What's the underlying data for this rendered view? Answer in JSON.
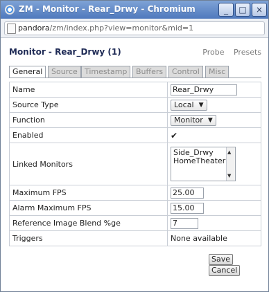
{
  "window": {
    "title": "ZM - Monitor - Rear_Drwy - Chromium",
    "controls": {
      "minimize": "_",
      "maximize": "□",
      "close": "×"
    }
  },
  "address_bar": {
    "host": "pandora",
    "path": "/zm/index.php?view=monitor&mid=1"
  },
  "page": {
    "heading": "Monitor - Rear_Drwy (1)",
    "links": {
      "probe": "Probe",
      "presets": "Presets"
    },
    "tabs": [
      {
        "label": "General",
        "active": true
      },
      {
        "label": "Source",
        "active": false
      },
      {
        "label": "Timestamp",
        "active": false
      },
      {
        "label": "Buffers",
        "active": false
      },
      {
        "label": "Control",
        "active": false
      },
      {
        "label": "Misc",
        "active": false
      }
    ],
    "fields": {
      "name": {
        "label": "Name",
        "value": "Rear_Drwy"
      },
      "source_type": {
        "label": "Source Type",
        "value": "Local"
      },
      "function": {
        "label": "Function",
        "value": "Monitor"
      },
      "enabled": {
        "label": "Enabled",
        "checked": true,
        "glyph": "✔"
      },
      "linked_monitors": {
        "label": "Linked Monitors",
        "options": [
          "Side_Drwy",
          "HomeTheater"
        ]
      },
      "max_fps": {
        "label": "Maximum FPS",
        "value": "25.00"
      },
      "alarm_max_fps": {
        "label": "Alarm Maximum FPS",
        "value": "15.00"
      },
      "ref_blend": {
        "label": "Reference Image Blend %ge",
        "value": "7"
      },
      "triggers": {
        "label": "Triggers",
        "value": "None available"
      }
    },
    "buttons": {
      "save": "Save",
      "cancel": "Cancel"
    }
  },
  "icons": {
    "select_arrow": "▼",
    "scroll_up": "▲",
    "scroll_down": "▼"
  }
}
